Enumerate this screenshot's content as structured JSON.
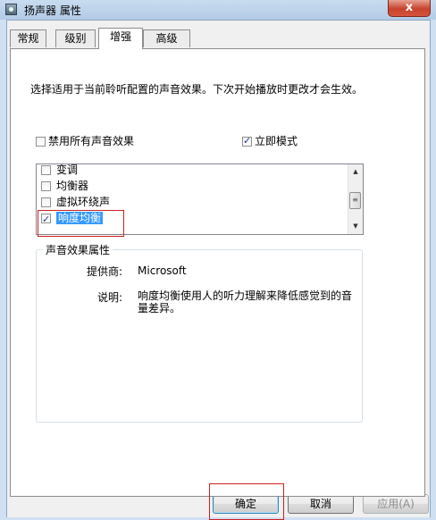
{
  "window": {
    "title": "扬声器 属性",
    "close_label": "x"
  },
  "tabs": [
    {
      "label": "常规",
      "active": false
    },
    {
      "label": "级别",
      "active": false
    },
    {
      "label": "增强",
      "active": true
    },
    {
      "label": "高级",
      "active": false
    }
  ],
  "enhancements": {
    "description": "选择适用于当前聆听配置的声音效果。下次开始播放时更改才会生效。",
    "disable_all": {
      "label": "禁用所有声音效果",
      "checked": false
    },
    "immediate_mode": {
      "label": "立即模式",
      "checked": true
    },
    "effects": [
      {
        "label": "变调",
        "checked": false
      },
      {
        "label": "均衡器",
        "checked": false
      },
      {
        "label": "虚拟环绕声",
        "checked": false
      },
      {
        "label": "响度均衡",
        "checked": true,
        "selected": true
      }
    ]
  },
  "properties": {
    "group_title": "声音效果属性",
    "provider_label": "提供商:",
    "provider_value": "Microsoft",
    "desc_label": "说明:",
    "desc_value": "响度均衡使用人的听力理解来降低感觉到的音量差异。"
  },
  "buttons": {
    "ok": "确定",
    "cancel": "取消",
    "apply": "应用(A)"
  },
  "colors": {
    "selection": "#3399ff",
    "highlight_box": "#d02020",
    "close_button": "#c7432d"
  }
}
